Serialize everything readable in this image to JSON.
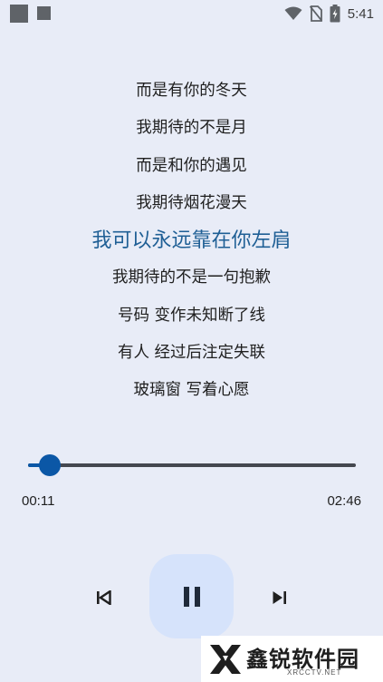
{
  "status_bar": {
    "time": "5:41",
    "icons": [
      "notification-square-icon",
      "notification-square-icon",
      "wifi-icon",
      "no-sim-icon",
      "battery-charging-icon"
    ]
  },
  "lyrics": [
    "而是有你的冬天",
    "我期待的不是月",
    "而是和你的遇见",
    "我期待烟花漫天",
    "我可以永远靠在你左肩",
    "我期待的不是一句抱歉",
    "号码 变作未知断了线",
    "有人 经过后注定失联",
    "玻璃窗 写着心愿"
  ],
  "active_lyric_index": 4,
  "player": {
    "elapsed": "00:11",
    "total": "02:46",
    "progress": 0.066,
    "state": "playing",
    "controls": [
      "skip-previous-icon",
      "pause-icon",
      "skip-next-icon"
    ]
  },
  "colors": {
    "background": "#e8ecf7",
    "accent": "#0b57a6",
    "active_lyric": "#1f5f95",
    "play_button_bg": "#d6e3fb"
  },
  "watermark": {
    "text": "鑫锐软件园",
    "subtext": "XRCCTV.NET"
  }
}
